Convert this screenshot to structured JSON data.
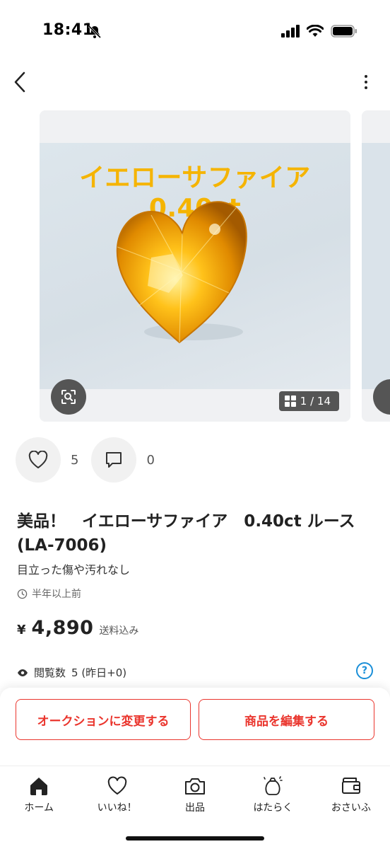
{
  "status_bar": {
    "time": "18:41"
  },
  "carousel": {
    "photo_caption": "イエローサファイア 0.40ct",
    "counter": "1 / 14"
  },
  "reactions": {
    "likes": "5",
    "comments": "0"
  },
  "item": {
    "title": "美品！　イエローサファイア　0.40ct ルース (LA-7006)",
    "subtitle": "目立った傷や汚れなし",
    "posted": "半年以上前",
    "currency": "¥",
    "price": "4,890",
    "shipping": "送料込み",
    "views_label": "閲覧数",
    "views_value": "5 (昨日+0)"
  },
  "actions": {
    "auction_label": "オークションに変更する",
    "edit_label": "商品を編集する"
  },
  "bottom_nav": {
    "items": [
      {
        "label": "ホーム",
        "icon": "home-icon"
      },
      {
        "label": "いいね！",
        "icon": "heart-icon"
      },
      {
        "label": "出品",
        "icon": "camera-icon"
      },
      {
        "label": "はたらく",
        "icon": "money-bag-icon"
      },
      {
        "label": "おさいふ",
        "icon": "wallet-icon"
      }
    ]
  },
  "colors": {
    "accent": "#ea352d",
    "link": "#1a8fd8",
    "gem": "#f5b400"
  }
}
